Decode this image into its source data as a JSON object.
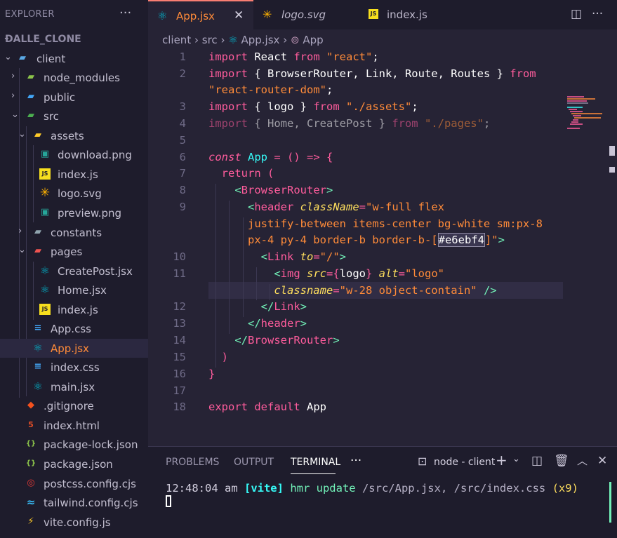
{
  "sidebar": {
    "title": "EXPLORER",
    "more": "···",
    "project": "DALLE_CLONE",
    "items": [
      {
        "label": "client",
        "icon": "folder-icon"
      },
      {
        "label": "node_modules",
        "icon": "folder-icon"
      },
      {
        "label": "public",
        "icon": "folder-icon"
      },
      {
        "label": "src",
        "icon": "folder-icon"
      },
      {
        "label": "assets",
        "icon": "folder-icon"
      },
      {
        "label": "download.png",
        "icon": "image-file-icon"
      },
      {
        "label": "index.js",
        "icon": "js-file-icon"
      },
      {
        "label": "logo.svg",
        "icon": "svg-file-icon"
      },
      {
        "label": "preview.png",
        "icon": "image-file-icon"
      },
      {
        "label": "constants",
        "icon": "folder-icon"
      },
      {
        "label": "pages",
        "icon": "folder-icon"
      },
      {
        "label": "CreatePost.jsx",
        "icon": "react-icon"
      },
      {
        "label": "Home.jsx",
        "icon": "react-icon"
      },
      {
        "label": "index.js",
        "icon": "js-file-icon"
      },
      {
        "label": "App.css",
        "icon": "css-file-icon"
      },
      {
        "label": "App.jsx",
        "icon": "react-icon"
      },
      {
        "label": "index.css",
        "icon": "css-file-icon"
      },
      {
        "label": "main.jsx",
        "icon": "react-icon"
      },
      {
        "label": ".gitignore",
        "icon": "git-icon"
      },
      {
        "label": "index.html",
        "icon": "html-file-icon"
      },
      {
        "label": "package-lock.json",
        "icon": "json-file-icon"
      },
      {
        "label": "package.json",
        "icon": "json-file-icon"
      },
      {
        "label": "postcss.config.cjs",
        "icon": "postcss-icon"
      },
      {
        "label": "tailwind.config.cjs",
        "icon": "tailwind-icon"
      },
      {
        "label": "vite.config.js",
        "icon": "vite-icon"
      }
    ]
  },
  "tabs": [
    {
      "label": "App.jsx",
      "active": true
    },
    {
      "label": "logo.svg",
      "active": false
    },
    {
      "label": "index.js",
      "active": false
    }
  ],
  "tab_close": "✕",
  "breadcrumb": {
    "part1": "client",
    "part2": "src",
    "part3": "App.jsx",
    "part4": "App",
    "sep": "›"
  },
  "code": {
    "line_numbers": [
      "1",
      "2",
      "3",
      "4",
      "5",
      "6",
      "7",
      "8",
      "9",
      "10",
      "11",
      "12",
      "13",
      "14",
      "15",
      "16",
      "17",
      "18"
    ],
    "l1_a": "import",
    "l1_b": " React ",
    "l1_c": "from",
    "l1_d": " \"react\"",
    "l1_e": ";",
    "l2_a": "import",
    "l2_b": " { BrowserRouter, Link, Route, Routes } ",
    "l2_c": "from",
    "l2w_a": "\"react-router-dom\"",
    "l2w_b": ";",
    "l3_a": "import",
    "l3_b": " { logo } ",
    "l3_c": "from",
    "l3_d": " \"./assets\"",
    "l3_e": ";",
    "l4_a": "import",
    "l4_b": " { Home, CreatePost } ",
    "l4_c": "from",
    "l4_d": " \"./pages\"",
    "l4_e": ";",
    "l6_a": "const",
    "l6_b": " App",
    "l6_c": " = () => {",
    "l7_a": "  return",
    "l7_b": " (",
    "l8_a": "    <",
    "l8_b": "BrowserRouter",
    "l8_c": ">",
    "l9_a": "      <",
    "l9_b": "header",
    "l9_c": " className",
    "l9_d": "=",
    "l9_e": "\"w-full flex",
    "l9w1": "      justify-between items-center bg-white sm:px-8",
    "l9w2_a": "      px-4 py-4 border-b border-b-[",
    "l9w2_b": "#e6ebf4",
    "l9w2_c": "]\"",
    "l9w2_d": ">",
    "l10_a": "        <",
    "l10_b": "Link",
    "l10_c": " to",
    "l10_d": "=",
    "l10_e": "\"/\"",
    "l10_f": ">",
    "l11_a": "          <",
    "l11_b": "img",
    "l11_c": " src",
    "l11_d": "={",
    "l11_e": "logo",
    "l11_f": "}",
    "l11_g": " alt",
    "l11_h": "=",
    "l11_i": "\"logo\"",
    "l11w_a": "          classname",
    "l11w_b": "=",
    "l11w_c": "\"w-28 object-contain\"",
    "l11w_d": " />",
    "l12_a": "        </",
    "l12_b": "Link",
    "l12_c": ">",
    "l13_a": "      </",
    "l13_b": "header",
    "l13_c": ">",
    "l14_a": "    </",
    "l14_b": "BrowserRouter",
    "l14_c": ">",
    "l15": "  )",
    "l16": "}",
    "l18_a": "export",
    "l18_b": " default",
    "l18_c": " App"
  },
  "panel": {
    "tabs": [
      "PROBLEMS",
      "OUTPUT",
      "TERMINAL"
    ],
    "more": "···",
    "terminal_name": "node - client",
    "terminal_line": {
      "time": "12:48:04 am ",
      "tag": "[vite]",
      "msg": " hmr update ",
      "files": "/src/App.jsx, /src/index.css ",
      "count": "(x9)"
    }
  },
  "colors": {
    "accent": "#f97e72",
    "background": "#262335",
    "sidebar": "#1e1c2c"
  }
}
